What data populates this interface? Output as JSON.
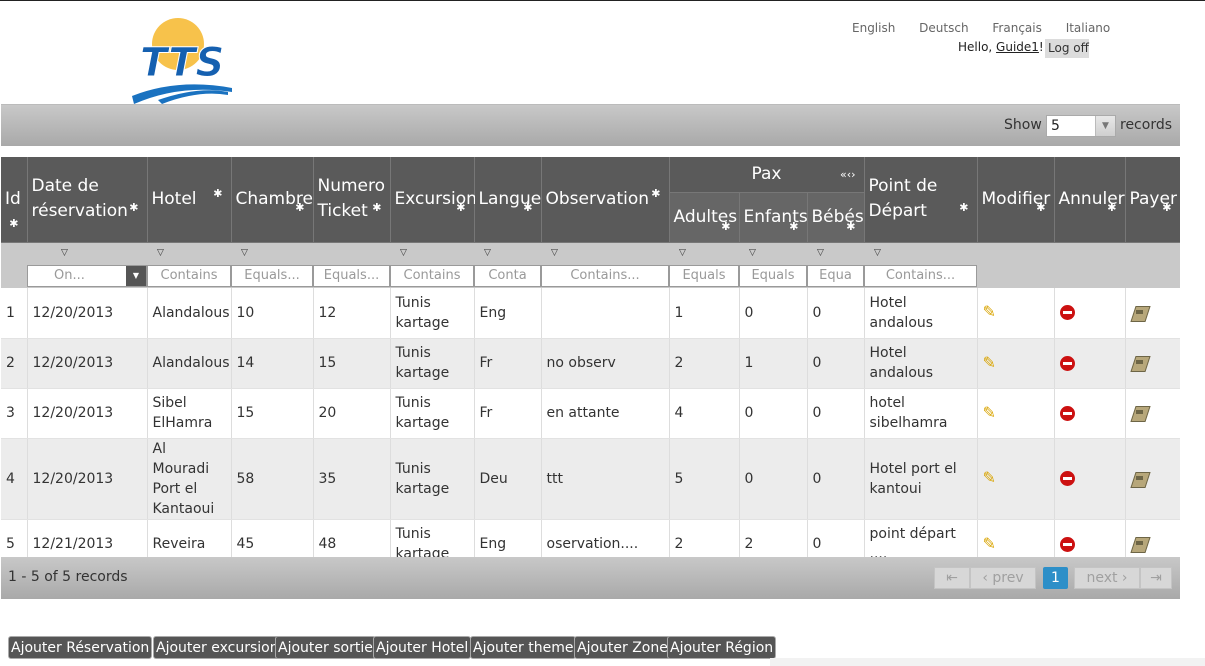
{
  "header": {
    "languages": [
      "English",
      "Deutsch",
      "Français",
      "Italiano"
    ],
    "greeting": "Hello, ",
    "username": "Guide1",
    "exclaim": "!",
    "logoff": "Log off"
  },
  "toolbar": {
    "show_label": "Show",
    "page_size": "5",
    "records_label": "records"
  },
  "grid": {
    "headers": {
      "id": "Id",
      "date": "Date de réservation",
      "hotel": "Hotel",
      "chambre": "Chambre",
      "ticket": "Numero Ticket",
      "excursion": "Excursion",
      "langue": "Langue",
      "observation": "Observation",
      "pax": "Pax",
      "adultes": "Adultes",
      "enfants": "Enfants",
      "bebes": "Bébés",
      "depart": "Point de Départ",
      "modifier": "Modifier",
      "annuler": "Annuler",
      "payer": "Payer"
    },
    "filters": {
      "date": "On...",
      "hotel": "Contains",
      "chambre": "Equals...",
      "ticket": "Equals...",
      "excursion": "Contains",
      "langue": "Conta",
      "observation": "Contains...",
      "adultes": "Equals",
      "enfants": "Equals",
      "bebes": "Equa",
      "depart": "Contains..."
    },
    "rows": [
      {
        "id": "1",
        "date": "12/20/2013",
        "hotel": "Alandalous",
        "chambre": "10",
        "ticket": "12",
        "excursion": "Tunis kartage",
        "langue": "Eng",
        "observation": "",
        "adultes": "1",
        "enfants": "0",
        "bebes": "0",
        "depart": "Hotel andalous"
      },
      {
        "id": "2",
        "date": "12/20/2013",
        "hotel": "Alandalous",
        "chambre": "14",
        "ticket": "15",
        "excursion": "Tunis kartage",
        "langue": "Fr",
        "observation": "no observ",
        "adultes": "2",
        "enfants": "1",
        "bebes": "0",
        "depart": "Hotel andalous"
      },
      {
        "id": "3",
        "date": "12/20/2013",
        "hotel": "Sibel ElHamra",
        "chambre": "15",
        "ticket": "20",
        "excursion": "Tunis kartage",
        "langue": "Fr",
        "observation": "en attante",
        "adultes": "4",
        "enfants": "0",
        "bebes": "0",
        "depart": "hotel sibelhamra"
      },
      {
        "id": "4",
        "date": "12/20/2013",
        "hotel": "Al Mouradi Port el Kantaoui",
        "chambre": "58",
        "ticket": "35",
        "excursion": "Tunis kartage",
        "langue": "Deu",
        "observation": "ttt",
        "adultes": "5",
        "enfants": "0",
        "bebes": "0",
        "depart": "Hotel port el kantoui"
      },
      {
        "id": "5",
        "date": "12/21/2013",
        "hotel": "Reveira",
        "chambre": "45",
        "ticket": "48",
        "excursion": "Tunis kartage",
        "langue": "Eng",
        "observation": "oservation....",
        "adultes": "2",
        "enfants": "2",
        "bebes": "0",
        "depart": "point départ ...."
      }
    ]
  },
  "pager": {
    "info": "1 - 5 of 5 records",
    "prev": "prev",
    "next": "next",
    "page": "1"
  },
  "actions": [
    "Ajouter Réservation",
    "Ajouter excursion",
    "Ajouter sortie",
    "Ajouter Hotel",
    "Ajouter theme",
    "Ajouter Zone",
    "Ajouter Région"
  ],
  "colors": {
    "header_bg": "#5a5a5a",
    "toolbar_bg": "#b8b8b8",
    "page_active": "#2d8fc8",
    "cancel_icon": "#cc1111"
  }
}
